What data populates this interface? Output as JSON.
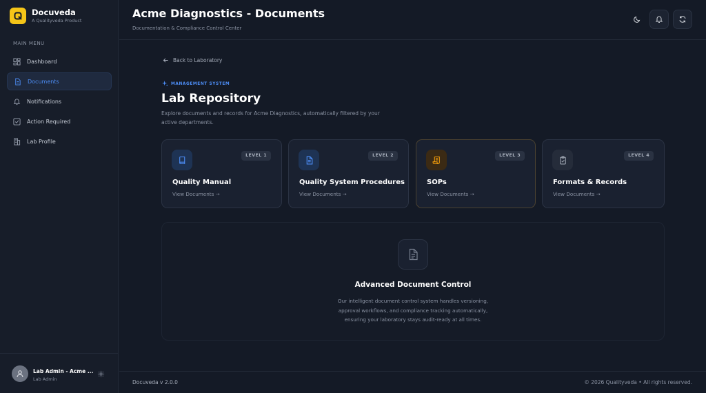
{
  "brand": {
    "name": "Docuveda",
    "tagline": "A Qualityveda Product"
  },
  "sidebar": {
    "heading": "MAIN MENU",
    "items": [
      {
        "label": "Dashboard",
        "icon": "dashboard-icon"
      },
      {
        "label": "Documents",
        "icon": "document-icon",
        "active": true
      },
      {
        "label": "Notifications",
        "icon": "bell-icon"
      },
      {
        "label": "Action Required",
        "icon": "checkbox-icon"
      },
      {
        "label": "Lab Profile",
        "icon": "building-icon"
      }
    ],
    "user": {
      "name": "Lab Admin - Acme ...",
      "role": "Lab Admin"
    }
  },
  "header": {
    "title": "Acme Diagnostics - Documents",
    "subtitle": "Documentation & Compliance Control Center"
  },
  "content": {
    "back_link": "Back to Laboratory",
    "eyebrow": "MANAGEMENT SYSTEM",
    "title": "Lab Repository",
    "description": "Explore documents and records for Acme Diagnostics, automatically filtered by your active departments.",
    "cards": [
      {
        "level": "LEVEL 1",
        "title": "Quality Manual",
        "link": "View Documents →",
        "icon": "book-icon",
        "accent": "#4d8ef7"
      },
      {
        "level": "LEVEL 2",
        "title": "Quality System Procedures",
        "link": "View Documents →",
        "icon": "file-text-icon",
        "accent": "#4d8ef7"
      },
      {
        "level": "LEVEL 3",
        "title": "SOPs",
        "link": "View Documents →",
        "icon": "scroll-icon",
        "accent": "#f59e0b"
      },
      {
        "level": "LEVEL 4",
        "title": "Formats & Records",
        "link": "View Documents →",
        "icon": "clipboard-check-icon",
        "accent": "#9ca3af"
      }
    ],
    "adc": {
      "title": "Advanced Document Control",
      "description": "Our intelligent document control system handles versioning, approval workflows, and compliance tracking automatically, ensuring your laboratory stays audit-ready at all times."
    }
  },
  "footer": {
    "version": "Docuveda v 2.0.0",
    "copyright": "© 2026 Qualityveda • All rights reserved."
  },
  "colors": {
    "accent": "#4d8ef7",
    "brand": "#f5c518",
    "background": "#141a26"
  }
}
